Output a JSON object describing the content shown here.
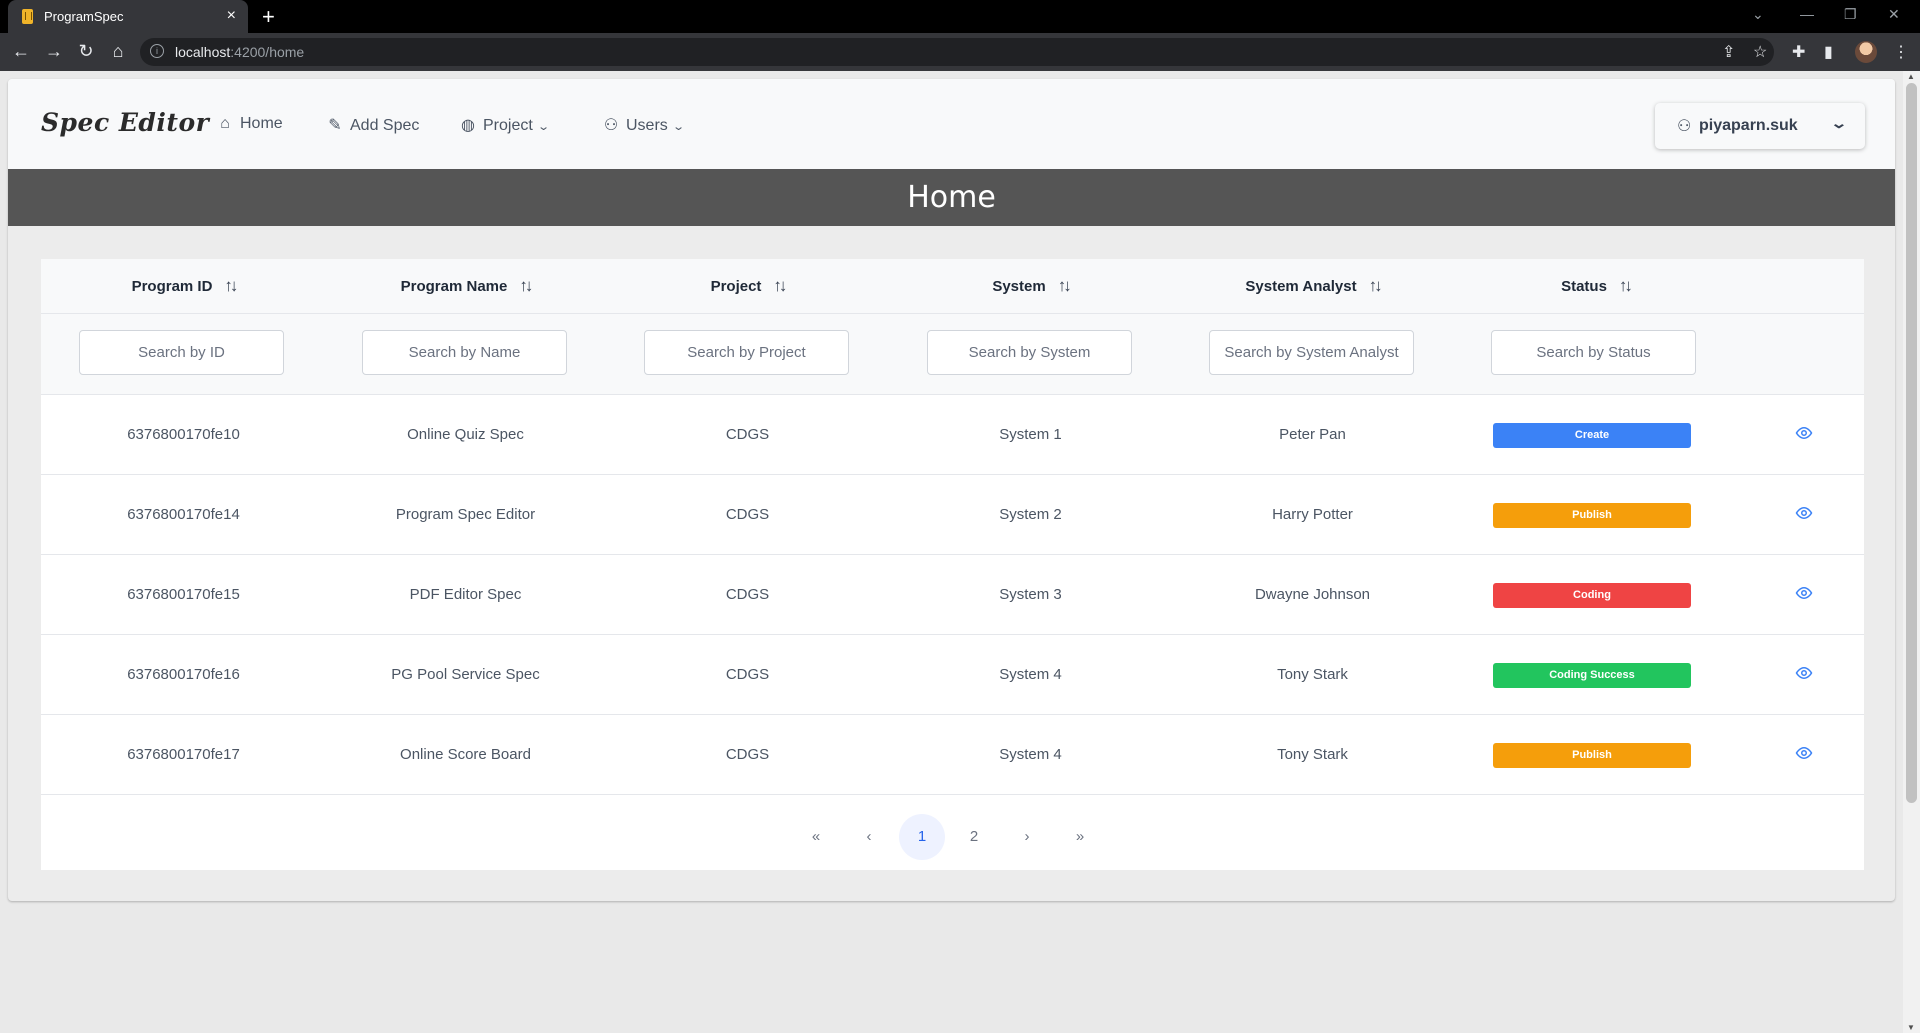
{
  "browser": {
    "tab_title": "ProgramSpec",
    "tab_close": "×",
    "new_tab": "+",
    "url_host": "localhost",
    "url_rest": ":4200/home",
    "window_controls": [
      "⌄",
      "—",
      "❐",
      "✕"
    ]
  },
  "navbar": {
    "brand": "Spec Editor",
    "items": [
      {
        "label": "Home",
        "icon": "home-icon"
      },
      {
        "label": "Add Spec",
        "icon": "pencil-icon"
      },
      {
        "label": "Project",
        "icon": "globe-icon",
        "dropdown": true
      },
      {
        "label": "Users",
        "icon": "user-icon",
        "dropdown": true
      }
    ],
    "user": {
      "name": "piyaparn.suk",
      "icon": "user-icon"
    }
  },
  "banner": {
    "title": "Home"
  },
  "table": {
    "columns": [
      {
        "label": "Program ID",
        "placeholder": "Search by ID"
      },
      {
        "label": "Program Name",
        "placeholder": "Search by Name"
      },
      {
        "label": "Project",
        "placeholder": "Search by Project"
      },
      {
        "label": "System",
        "placeholder": "Search by System"
      },
      {
        "label": "System Analyst",
        "placeholder": "Search by System Analyst"
      },
      {
        "label": "Status",
        "placeholder": "Search by Status"
      }
    ],
    "rows": [
      {
        "id": "6376800170fe10",
        "name": "Online Quiz Spec",
        "project": "CDGS",
        "system": "System 1",
        "analyst": "Peter Pan",
        "status": "Create",
        "status_color": "#3b82f6"
      },
      {
        "id": "6376800170fe14",
        "name": "Program Spec Editor",
        "project": "CDGS",
        "system": "System 2",
        "analyst": "Harry Potter",
        "status": "Publish",
        "status_color": "#f59e0b"
      },
      {
        "id": "6376800170fe15",
        "name": "PDF Editor Spec",
        "project": "CDGS",
        "system": "System 3",
        "analyst": "Dwayne Johnson",
        "status": "Coding",
        "status_color": "#ef4444"
      },
      {
        "id": "6376800170fe16",
        "name": "PG Pool Service Spec",
        "project": "CDGS",
        "system": "System 4",
        "analyst": "Tony Stark",
        "status": "Coding Success",
        "status_color": "#22c55e"
      },
      {
        "id": "6376800170fe17",
        "name": "Online Score Board",
        "project": "CDGS",
        "system": "System 4",
        "analyst": "Tony Stark",
        "status": "Publish",
        "status_color": "#f59e0b"
      }
    ]
  },
  "pagination": {
    "first": "«",
    "prev": "‹",
    "pages": [
      "1",
      "2"
    ],
    "current": "1",
    "next": "›",
    "last": "»"
  },
  "colors": {
    "accent": "#2563eb",
    "banner": "#555555"
  }
}
